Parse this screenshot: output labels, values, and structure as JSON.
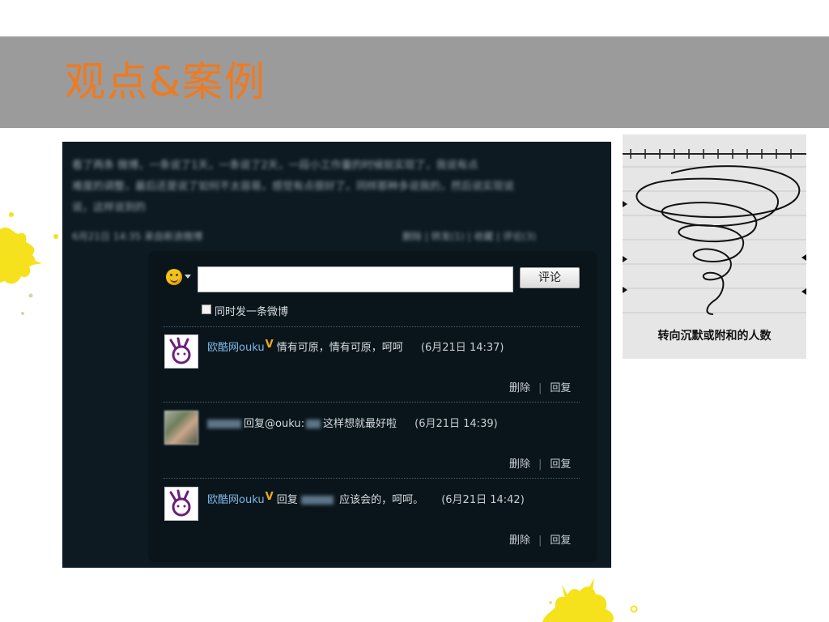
{
  "title": "观点&案例",
  "colors": {
    "banner": "#9b9b9b",
    "title": "#f07a1e",
    "splat": "#f6e21c",
    "panel": "#0a151b",
    "username": "#7eb7e8",
    "verified": "#f0a91a"
  },
  "post": {
    "text_lines": [
      "看了两条 微博，一条说了1天，一条说了2天，一段小工作量的时候就实现了，我说有点",
      "难度的调整，最后还是说了如何不太容易，感觉有点很好了。同样那种多说我的，然后说实现说",
      "说，这样说到的"
    ],
    "meta": "6月21日 14:35  来自新浪微博",
    "links": [
      "删除",
      "转发(1)",
      "收藏",
      "评论(3)"
    ]
  },
  "comment_box": {
    "emoji_icon": "smiley-icon",
    "input_value": "",
    "submit_label": "评论",
    "also_post_label": "同时发一条微博"
  },
  "comments": [
    {
      "user": "欧酷网ouku",
      "verified": "V",
      "text": "情有可原，情有可原，呵呵",
      "time": "(6月21日  14:37)",
      "delete": "删除",
      "reply": "回复",
      "avatar": "bunny-avatar-icon"
    },
    {
      "user": "",
      "verified": "",
      "reply_prefix": "回复",
      "mention": "@ouku",
      "mention_sep": ":",
      "text": "这样想就最好啦",
      "time": "(6月21日  14:39)",
      "delete": "删除",
      "reply": "回复",
      "avatar": "photo-avatar"
    },
    {
      "user": "欧酷网ouku",
      "verified": "V",
      "reply_prefix": "回复",
      "text": "应该会的，呵呵。",
      "time": "(6月21日  14:42)",
      "delete": "删除",
      "reply": "回复",
      "avatar": "bunny-avatar-icon"
    }
  ],
  "reference_image": {
    "caption": "转向沉默或附和的人数"
  }
}
